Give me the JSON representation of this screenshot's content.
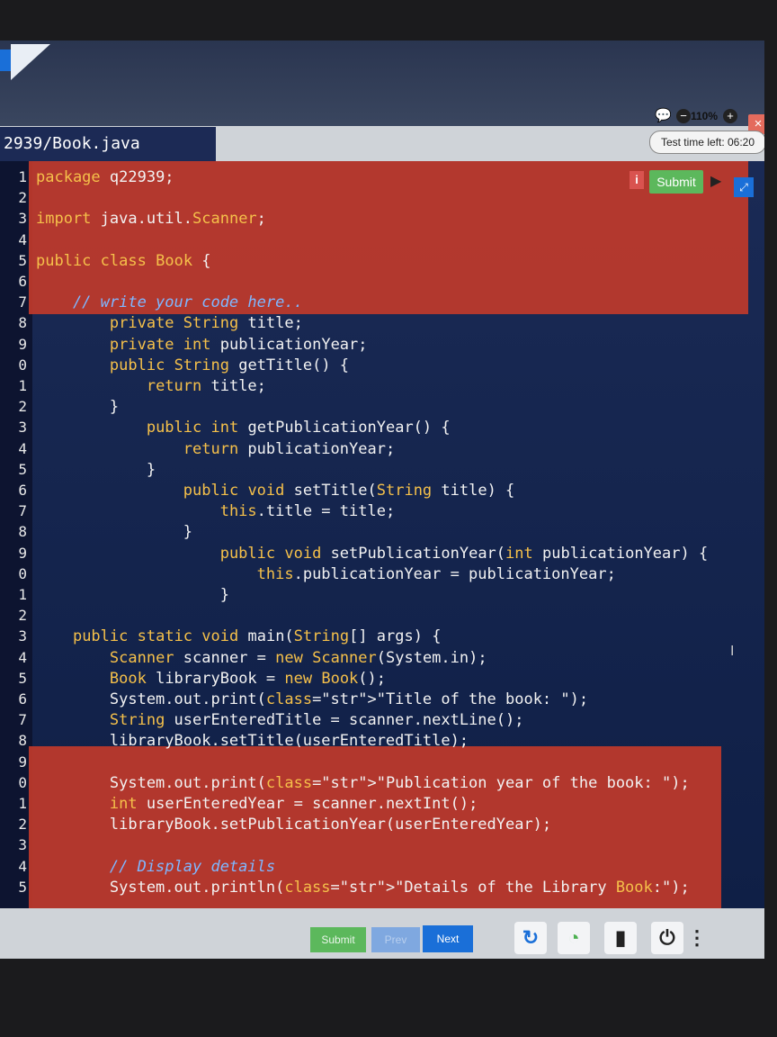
{
  "file_tab": {
    "title": "2939/Book.java"
  },
  "toolbar": {
    "zoom": "110%",
    "zoom_minus": "−",
    "zoom_plus": "+",
    "close": "×",
    "timer": "Test time left: 06:20",
    "info": "i",
    "submit": "Submit",
    "icons": [
      "chat-icon",
      "play-icon",
      "expand-icon"
    ]
  },
  "editor": {
    "line_numbers": [
      "1",
      "2",
      "3",
      "4",
      "5",
      "6",
      "7",
      "8",
      "9",
      "0",
      "1",
      "2",
      "3",
      "4",
      "5",
      "6",
      "7",
      "8",
      "9",
      "0",
      "1",
      "2",
      "3",
      "4",
      "5",
      "6",
      "7",
      "8",
      "9",
      "0",
      "1",
      "2",
      "3",
      "4",
      "5"
    ],
    "lines": [
      "package q22939;",
      "",
      "import java.util.Scanner;",
      "",
      "public class Book {",
      "",
      "    // write your code here..",
      "        private String title;",
      "        private int publicationYear;",
      "        public String getTitle() {",
      "            return title;",
      "        }",
      "            public int getPublicationYear() {",
      "                return publicationYear;",
      "            }",
      "                public void setTitle(String title) {",
      "                    this.title = title;",
      "                }",
      "                    public void setPublicationYear(int publicationYear) {",
      "                        this.publicationYear = publicationYear;",
      "                    }",
      "",
      "    public static void main(String[] args) {",
      "        Scanner scanner = new Scanner(System.in);",
      "        Book libraryBook = new Book();",
      "        System.out.print(\"Title of the book: \");",
      "        String userEnteredTitle = scanner.nextLine();",
      "        libraryBook.setTitle(userEnteredTitle);",
      "",
      "        System.out.print(\"Publication year of the book: \");",
      "        int userEnteredYear = scanner.nextInt();",
      "        libraryBook.setPublicationYear(userEnteredYear);",
      "",
      "        // Display details",
      "        System.out.println(\"Details of the Library Book:\");"
    ]
  },
  "bottom_bar": {
    "submit": "Submit",
    "prev": "Prev",
    "next": "Next",
    "icons": [
      "refresh-icon",
      "wifi-icon",
      "battery-icon",
      "power-icon",
      "more-icon"
    ]
  },
  "colors": {
    "editor_bg": "#1a2a55",
    "highlight": "#c0392b",
    "keyword": "#f5c04a",
    "comment": "#7fb7ff",
    "submit": "#5cb85c",
    "next": "#1a6fd8"
  }
}
